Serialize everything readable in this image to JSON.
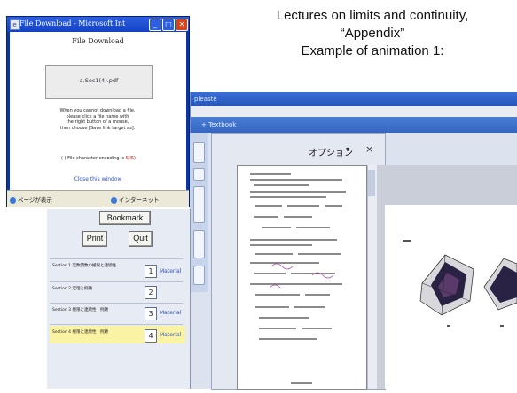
{
  "slide": {
    "line1": "Lectures on limits and continuity,",
    "line2": "“Appendix”",
    "line3": "Example of animation 1:"
  },
  "app_window": {
    "title": "pleaste",
    "toolbar_label": "+ Textbook"
  },
  "options_pane": {
    "label": "オプション",
    "dropdown_glyph": "▾",
    "close_glyph": "×"
  },
  "course_panel": {
    "bookmark": "Bookmark",
    "print": "Print",
    "quit": "Quit",
    "sections": [
      {
        "text": "Section 1 定数関数の極限と連続性",
        "num": "1",
        "material": "Material"
      },
      {
        "text": "Section 2 定理と例題",
        "num": "2",
        "material": ""
      },
      {
        "text": "Section 3 極限と連続性　例題",
        "num": "3",
        "material": "Material"
      },
      {
        "text": "Section 4 極限と連続性　例題",
        "num": "4",
        "material": "Material"
      }
    ]
  },
  "download_dialog": {
    "title": "File Download - Microsoft Int",
    "heading": "File Download",
    "file_button": "a.Sec1(4).pdf",
    "instructions": [
      "When you cannot download a file,",
      "please click a file name with",
      "the right button of a mouse,",
      "then choose [Save link target as]."
    ],
    "size_prefix": "( ) File character encoding is",
    "size_value": "SJIS",
    "size_suffix": ")",
    "close_link": "Close this window",
    "status_left": "ページが表示",
    "status_right": "インターネット"
  },
  "colors": {
    "dialog_title": "#1442c5",
    "link": "#2b55c8",
    "highlight_row": "#fbf3a4"
  }
}
